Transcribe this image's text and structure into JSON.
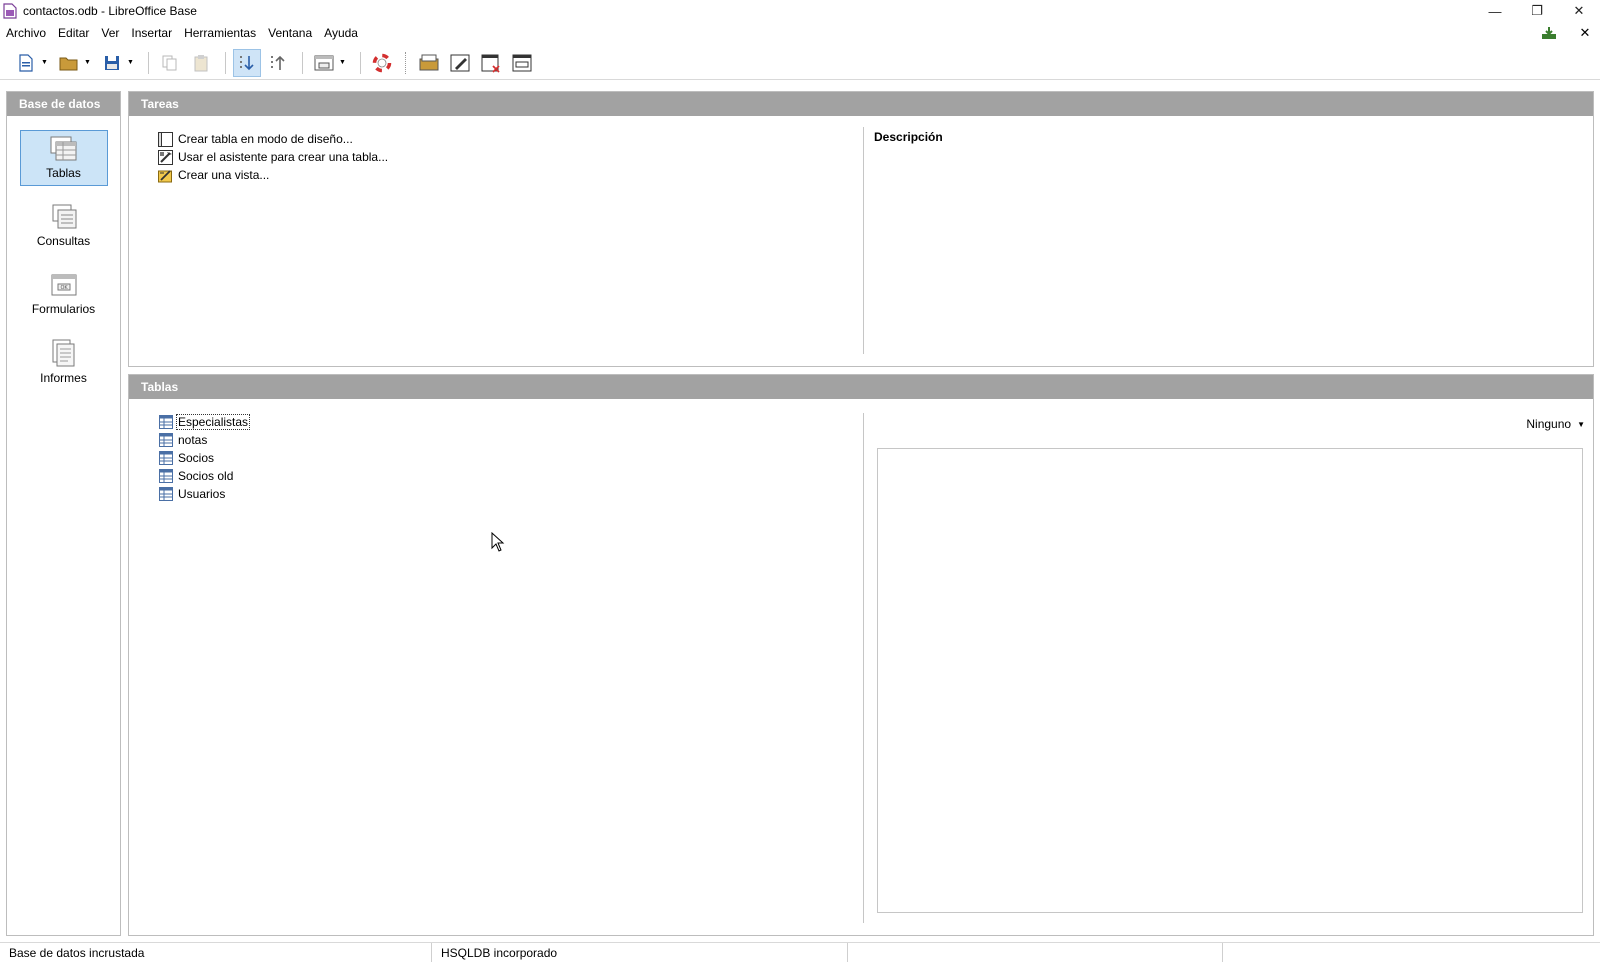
{
  "window": {
    "title": "contactos.odb - LibreOffice Base",
    "minimize_glyph": "—",
    "restore_glyph": "❐",
    "close_glyph": "✕"
  },
  "menu": {
    "items": [
      "Archivo",
      "Editar",
      "Ver",
      "Insertar",
      "Herramientas",
      "Ventana",
      "Ayuda"
    ],
    "close_doc_glyph": "✕"
  },
  "sidebar": {
    "header": "Base de datos",
    "items": [
      {
        "label": "Tablas",
        "icon": "tables-icon",
        "selected": true
      },
      {
        "label": "Consultas",
        "icon": "queries-icon",
        "selected": false
      },
      {
        "label": "Formularios",
        "icon": "forms-icon",
        "selected": false
      },
      {
        "label": "Informes",
        "icon": "reports-icon",
        "selected": false
      }
    ]
  },
  "tasks": {
    "header": "Tareas",
    "items": [
      {
        "label": "Crear tabla en modo de diseño...",
        "icon": "design-table-icon"
      },
      {
        "label": "Usar el asistente para crear una tabla...",
        "icon": "table-wizard-icon"
      },
      {
        "label": "Crear una vista...",
        "icon": "create-view-icon"
      }
    ],
    "description_title": "Descripción"
  },
  "tables": {
    "header": "Tablas",
    "items": [
      "Especialistas",
      "notas",
      "Socios",
      "Socios old",
      "Usuarios"
    ],
    "preview_mode": "Ninguno"
  },
  "statusbar": {
    "cells": [
      "Base de datos incrustada",
      "HSQLDB incorporado",
      "",
      ""
    ]
  },
  "colors": {
    "header_bg": "#a2a2a2",
    "selected_bg": "#cce4f7",
    "selected_border": "#5a9ad6"
  }
}
